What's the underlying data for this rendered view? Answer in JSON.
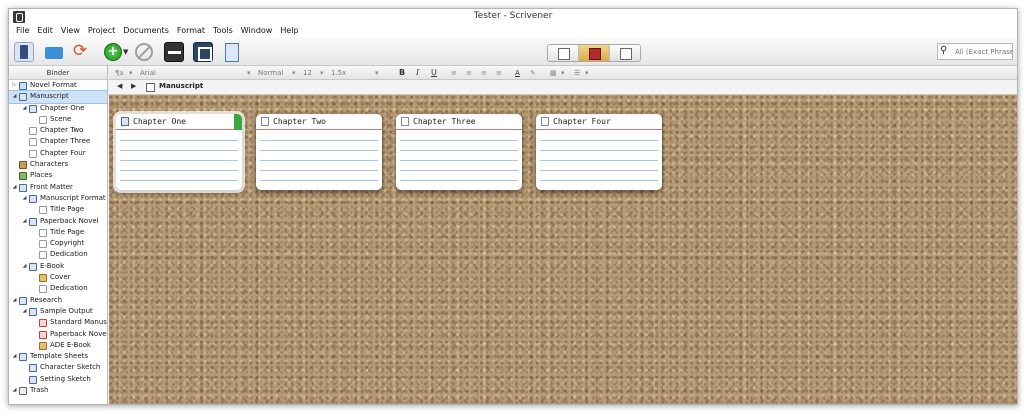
{
  "window": {
    "title": "Tester - Scrivener"
  },
  "menu": [
    "File",
    "Edit",
    "View",
    "Project",
    "Documents",
    "Format",
    "Tools",
    "Window",
    "Help"
  ],
  "search": {
    "placeholder": "All (Exact Phrase)"
  },
  "binder": {
    "header": "Binder",
    "items": [
      {
        "label": "Novel Format",
        "icon": "triangle-icon"
      },
      {
        "label": "Manuscript",
        "icon": "folder-icon",
        "selected": true
      },
      {
        "label": "Chapter One",
        "icon": "folder-icon"
      },
      {
        "label": "Scene",
        "icon": "document-icon"
      },
      {
        "label": "Chapter Two",
        "icon": "document-icon"
      },
      {
        "label": "Chapter Three",
        "icon": "document-icon"
      },
      {
        "label": "Chapter Four",
        "icon": "document-icon"
      },
      {
        "label": "Characters",
        "icon": "characters-icon"
      },
      {
        "label": "Places",
        "icon": "places-icon"
      },
      {
        "label": "Front Matter",
        "icon": "folder-icon"
      },
      {
        "label": "Manuscript Format",
        "icon": "folder-icon"
      },
      {
        "label": "Title Page",
        "icon": "document-icon"
      },
      {
        "label": "Paperback Novel",
        "icon": "folder-icon"
      },
      {
        "label": "Title Page",
        "icon": "document-icon"
      },
      {
        "label": "Copyright",
        "icon": "document-icon"
      },
      {
        "label": "Dedication",
        "icon": "document-icon"
      },
      {
        "label": "E-Book",
        "icon": "folder-icon"
      },
      {
        "label": "Cover",
        "icon": "image-icon"
      },
      {
        "label": "Dedication",
        "icon": "document-icon"
      },
      {
        "label": "Research",
        "icon": "research-icon"
      },
      {
        "label": "Sample Output",
        "icon": "folder-icon"
      },
      {
        "label": "Standard Manuscr...",
        "icon": "pdf-icon"
      },
      {
        "label": "Paperback Novel",
        "icon": "pdf-icon"
      },
      {
        "label": "ADE E-Book",
        "icon": "image-icon"
      },
      {
        "label": "Template Sheets",
        "icon": "folder-icon"
      },
      {
        "label": "Character Sketch",
        "icon": "template-icon"
      },
      {
        "label": "Setting Sketch",
        "icon": "template-icon"
      },
      {
        "label": "Trash",
        "icon": "trash-icon"
      }
    ]
  },
  "format_bar": {
    "style": "¶a",
    "font": "Arial",
    "weight": "Normal",
    "size": "12",
    "spacing": "1.5x",
    "bold": "B",
    "italic": "I",
    "underline": "U",
    "text_color": "A"
  },
  "header": {
    "title": "Manuscript"
  },
  "corkboard": {
    "cards": [
      {
        "title": "Chapter One",
        "label_color": "#3aa83a",
        "selected": true
      },
      {
        "title": "Chapter Two"
      },
      {
        "title": "Chapter Three"
      },
      {
        "title": "Chapter Four"
      }
    ]
  }
}
